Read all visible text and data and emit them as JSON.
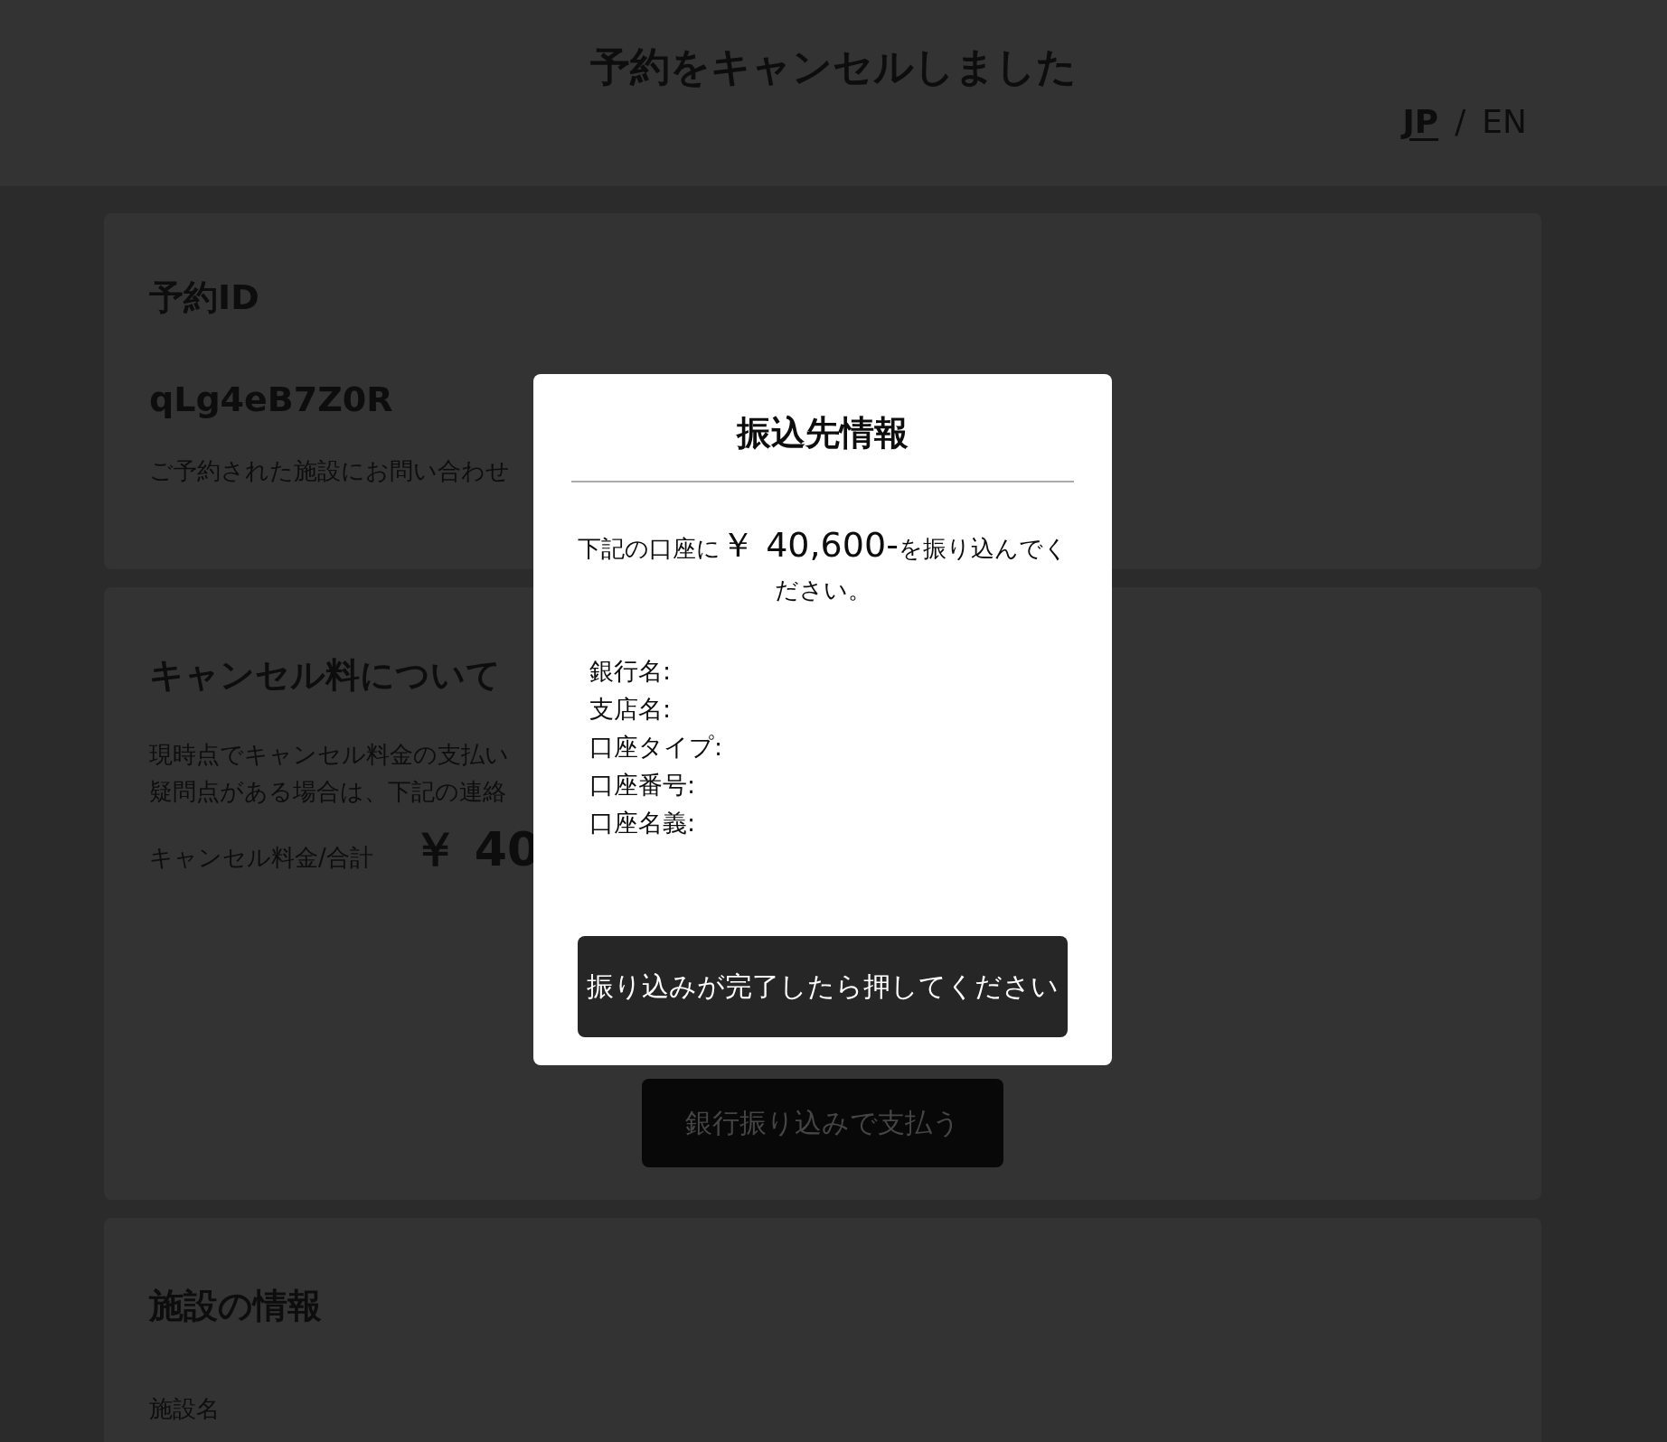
{
  "header": {
    "title": "予約をキャンセルしました",
    "separator": "/",
    "languages": [
      {
        "label": "JP",
        "selected": true
      },
      {
        "label": "EN",
        "selected": false
      }
    ]
  },
  "reservation": {
    "heading": "予約ID",
    "id": "qLg4eB7Z0R",
    "note": "ご予約された施設にお問い合わせ"
  },
  "cancellation": {
    "heading": "キャンセル料について",
    "lines": [
      "現時点でキャンセル料金の支払い",
      "疑問点がある場合は、下記の連絡"
    ],
    "total_label": "キャンセル料金/合計",
    "total_amount": "￥ 40",
    "pay_button": "銀行振り込みで支払う"
  },
  "facility": {
    "heading": "施設の情報",
    "name_label": "施設名"
  },
  "dialog": {
    "title": "振込先情報",
    "message_before": "下記の口座に",
    "amount": "￥ 40,600-",
    "message_after": "を振り込んでください。",
    "fields": [
      "銀行名:",
      "支店名:",
      "口座タイプ:",
      "口座番号:",
      "口座名義:"
    ],
    "confirm_button": "振り込みが完了したら押してください"
  }
}
